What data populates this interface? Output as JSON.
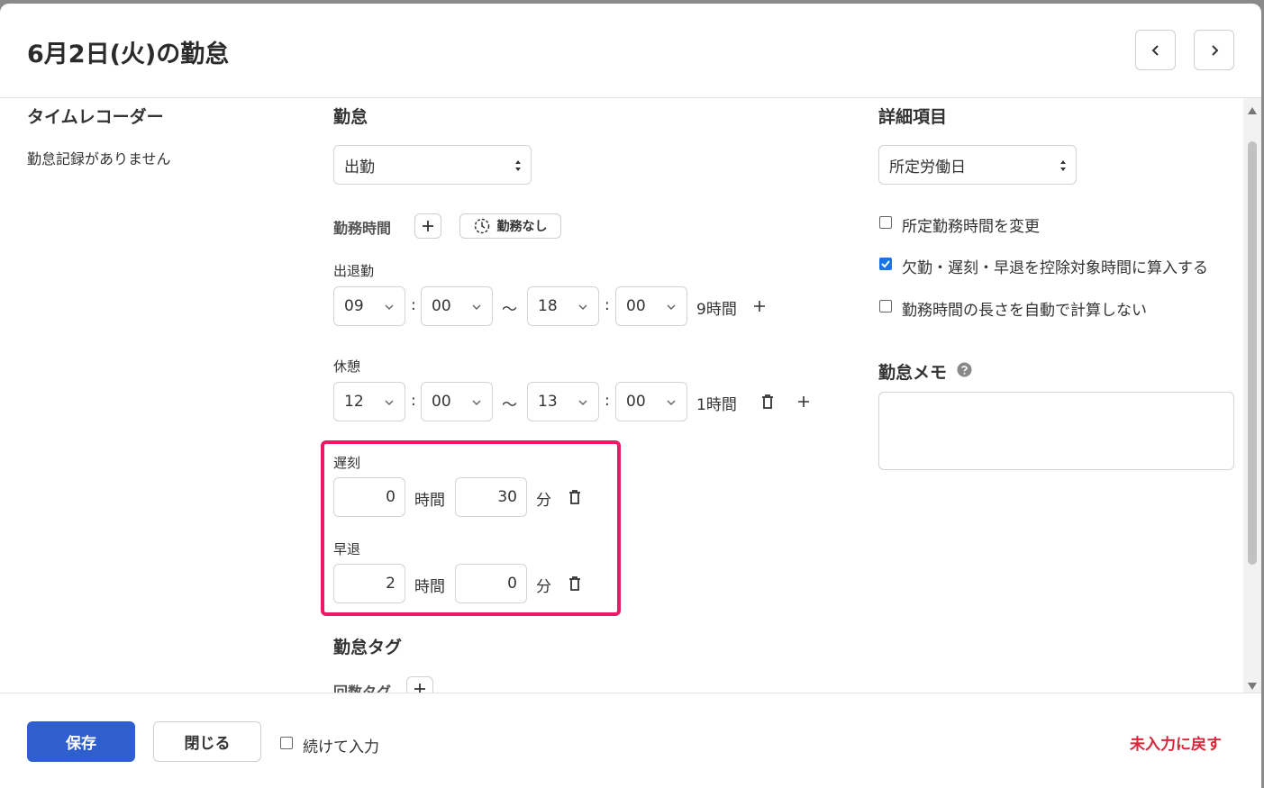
{
  "title": "6月2日(火)の勤怠",
  "left": {
    "heading": "タイムレコーダー",
    "empty_text": "勤怠記録がありません"
  },
  "middle": {
    "heading": "勤怠",
    "attendance_type": "出勤",
    "work_time_label": "勤務時間",
    "no_work_label": "勤務なし",
    "shift_label": "出退勤",
    "shift": {
      "start_h": "09",
      "start_m": "00",
      "end_h": "18",
      "end_m": "00",
      "duration": "9時間"
    },
    "break_label": "休憩",
    "break": {
      "start_h": "12",
      "start_m": "00",
      "end_h": "13",
      "end_m": "00",
      "duration": "1時間"
    },
    "colon": ":",
    "tilde": "～",
    "late_label": "遅刻",
    "late": {
      "hours": "0",
      "minutes": "30"
    },
    "early_label": "早退",
    "early": {
      "hours": "2",
      "minutes": "0"
    },
    "hours_unit": "時間",
    "minutes_unit": "分",
    "tags_heading": "勤怠タグ",
    "count_tag_label": "回数タグ"
  },
  "right": {
    "heading": "詳細項目",
    "day_type": "所定労働日",
    "checks": [
      {
        "label": "所定勤務時間を変更",
        "checked": false
      },
      {
        "label": "欠勤・遅刻・早退を控除対象時間に算入する",
        "checked": true
      },
      {
        "label": "勤務時間の長さを自動で計算しない",
        "checked": false
      }
    ],
    "memo_heading": "勤怠メモ",
    "memo_value": ""
  },
  "footer": {
    "save": "保存",
    "close": "閉じる",
    "continue_label": "続けて入力",
    "reset": "未入力に戻す"
  },
  "colors": {
    "primary": "#2f5fcf",
    "highlight": "#ee1867",
    "reset": "#d8263a",
    "check": "#1a73e8"
  }
}
